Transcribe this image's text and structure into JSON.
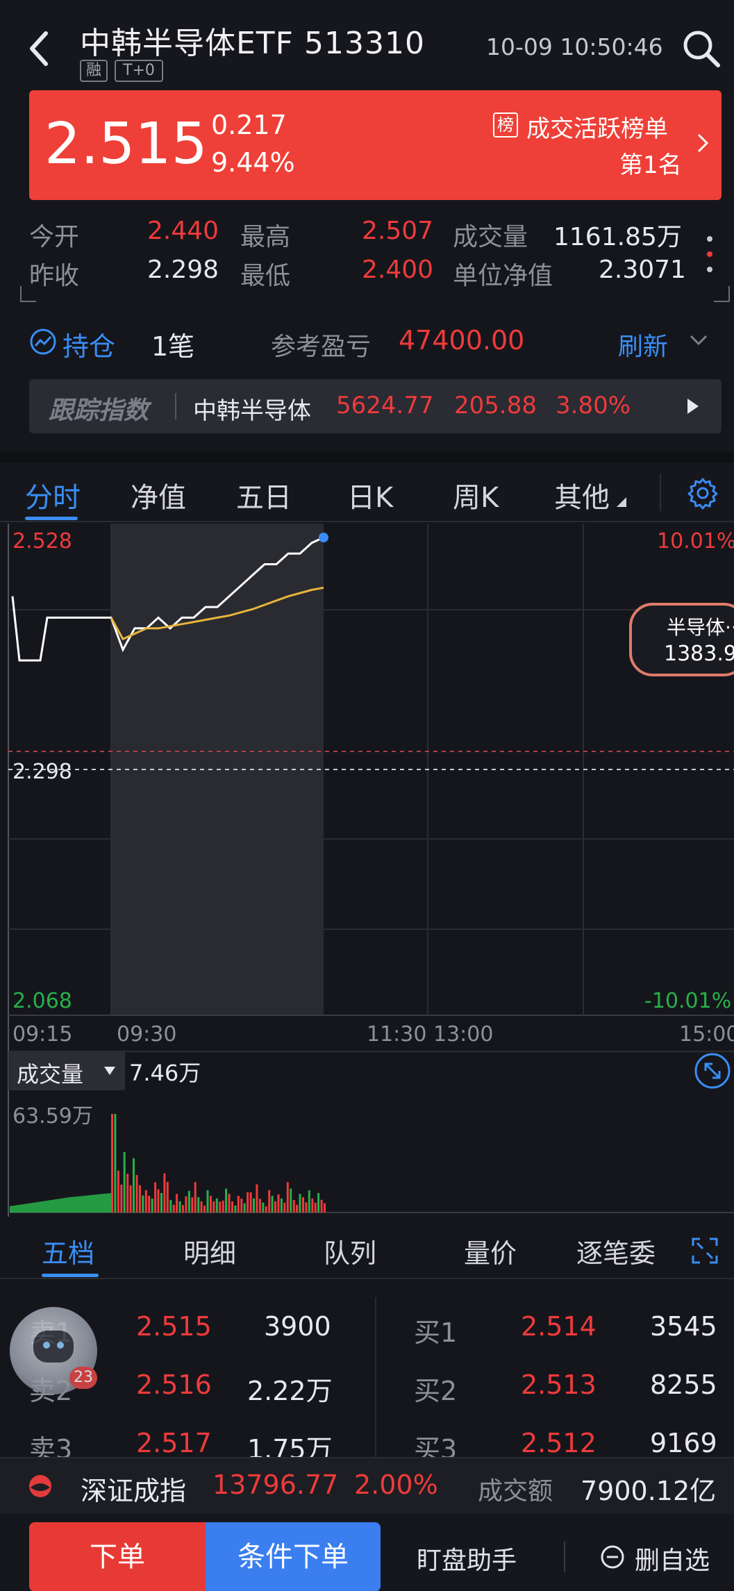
{
  "header": {
    "title": "中韩半导体ETF 513310",
    "tag_margin": "融",
    "tag_t0": "T+0",
    "datetime": "10-09 10:50:46"
  },
  "quote": {
    "price": "2.515",
    "change": "0.217",
    "change_pct": "9.44%",
    "rank_badge": "榜",
    "rank_label": "成交活跃榜单",
    "rank_value": "第1名"
  },
  "stats": {
    "open_label": "今开",
    "open": "2.440",
    "high_label": "最高",
    "high": "2.507",
    "volume_label": "成交量",
    "volume": "1161.85万",
    "prev_close_label": "昨收",
    "prev_close": "2.298",
    "low_label": "最低",
    "low": "2.400",
    "nav_label": "单位净值",
    "nav": "2.3071"
  },
  "holdings": {
    "label": "持仓",
    "count": "1笔",
    "pnl_label": "参考盈亏",
    "pnl": "47400.00",
    "refresh": "刷新"
  },
  "tracking": {
    "label": "跟踪指数",
    "index_name": "中韩半导体",
    "value": "5624.77",
    "change": "205.88",
    "change_pct": "3.80%"
  },
  "chart_tabs": [
    "分时",
    "净值",
    "五日",
    "日K",
    "周K",
    "其他"
  ],
  "chart": {
    "price_high": "2.528",
    "price_mid": "2.298",
    "price_low": "2.068",
    "pct_high": "10.01%",
    "pct_low": "-10.01%",
    "x_labels": [
      "09:15",
      "09:30",
      "11:30 13:00",
      "15:00"
    ],
    "sector_bubble_name": "半导体··",
    "sector_bubble_value": "1383.9",
    "volume_label": "成交量",
    "volume_current": "7.46万",
    "volume_max": "63.59万",
    "colors": {
      "up": "#ee3b3b",
      "down": "#27b14a",
      "price_line": "#ffffff",
      "avg_line": "#e7b53a"
    }
  },
  "chart_data": {
    "type": "line",
    "title": "",
    "xlabel": "",
    "ylabel": "",
    "ylim": [
      2.068,
      2.528
    ],
    "x": [
      "09:15",
      "09:16",
      "09:17",
      "09:18",
      "09:20",
      "09:25",
      "09:30",
      "09:33",
      "09:36",
      "09:40",
      "09:44",
      "09:48",
      "09:52",
      "09:56",
      "10:00",
      "10:05",
      "10:10",
      "10:15",
      "10:20",
      "10:25",
      "10:30",
      "10:35",
      "10:40",
      "10:45",
      "10:50"
    ],
    "series": [
      {
        "values": [
          2.46,
          2.4,
          2.4,
          2.4,
          2.4,
          2.44,
          2.44,
          2.41,
          2.43,
          2.43,
          2.44,
          2.43,
          2.44,
          2.44,
          2.45,
          2.45,
          2.46,
          2.47,
          2.48,
          2.49,
          2.49,
          2.5,
          2.5,
          2.51,
          2.515
        ]
      },
      {
        "values": [
          null,
          null,
          null,
          null,
          null,
          null,
          2.44,
          2.42,
          2.425,
          2.43,
          2.43,
          2.432,
          2.434,
          2.436,
          2.438,
          2.44,
          2.442,
          2.445,
          2.448,
          2.452,
          2.456,
          2.46,
          2.463,
          2.466,
          2.468
        ]
      }
    ],
    "volume": [
      63.59,
      30,
      25,
      22,
      12,
      15,
      18,
      10,
      8,
      14,
      9,
      12,
      7,
      11,
      9,
      10,
      13,
      8,
      12,
      9,
      14,
      10,
      11,
      9,
      7.46
    ]
  },
  "orderbook_tabs": [
    "五档",
    "明细",
    "队列",
    "量价",
    "逐笔委"
  ],
  "orderbook": {
    "asks": [
      {
        "label": "卖1",
        "price": "2.515",
        "volume": "3900"
      },
      {
        "label": "卖2",
        "price": "2.516",
        "volume": "2.22万"
      },
      {
        "label": "卖3",
        "price": "2.517",
        "volume": "1.75万"
      }
    ],
    "bids": [
      {
        "label": "买1",
        "price": "2.514",
        "volume": "3545"
      },
      {
        "label": "买2",
        "price": "2.513",
        "volume": "8255"
      },
      {
        "label": "买3",
        "price": "2.512",
        "volume": "9169"
      }
    ],
    "assistant_badge": "23"
  },
  "index_bar": {
    "name": "深证成指",
    "value": "13796.77",
    "change_pct": "2.00%",
    "turnover_label": "成交额",
    "turnover": "7900.12亿"
  },
  "actions": {
    "order": "下单",
    "conditional_order": "条件下单",
    "monitor_assistant": "盯盘助手",
    "remove_watch": "删自选"
  }
}
